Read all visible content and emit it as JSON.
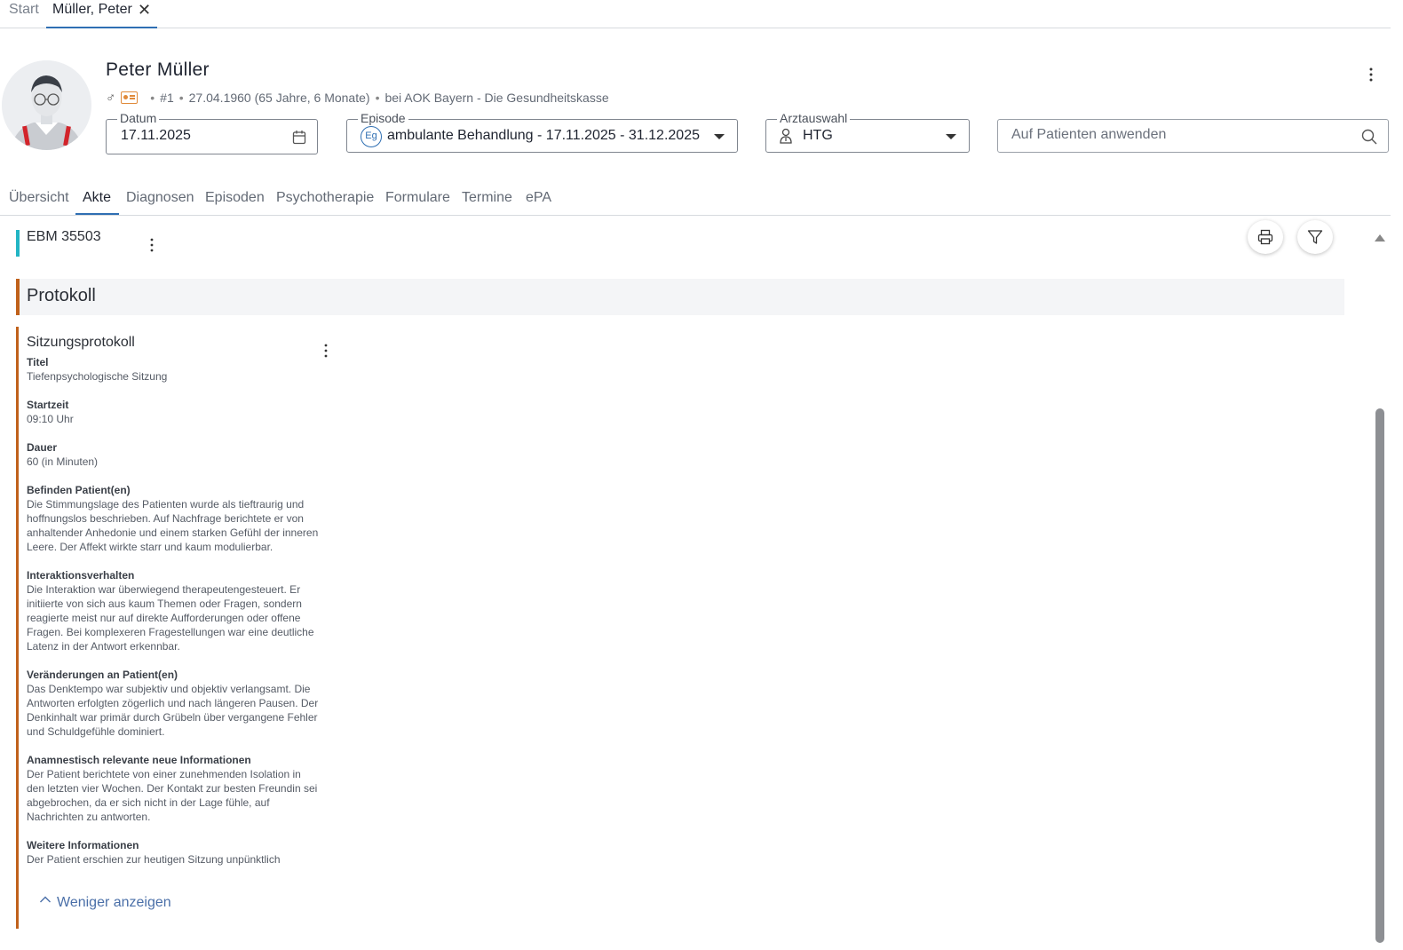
{
  "top_tabs": {
    "start": "Start",
    "patient_tab": "Müller, Peter",
    "close_symbol": "✕"
  },
  "patient": {
    "name": "Peter Müller",
    "gender_symbol": "♂",
    "number": "#1",
    "birth": "27.04.1960 (65 Jahre, 6 Monate)",
    "insurance": "bei AOK Bayern - Die Gesundheitskasse",
    "separator": "•"
  },
  "fields": {
    "datum": {
      "label": "Datum",
      "value": "17.11.2025"
    },
    "episode": {
      "label": "Episode",
      "badge": "Eg",
      "value": "ambulante Behandlung - 17.11.2025 - 31.12.2025"
    },
    "arzt": {
      "label": "Arztauswahl",
      "value": "HTG"
    },
    "search": {
      "placeholder": "Auf Patienten anwenden"
    }
  },
  "section_tabs": [
    "Übersicht",
    "Akte",
    "Diagnosen",
    "Episoden",
    "Psychotherapie",
    "Formulare",
    "Termine",
    "ePA"
  ],
  "ebm": {
    "title": "EBM 35503"
  },
  "protocol": {
    "header": "Protokoll",
    "session_title": "Sitzungsprotokoll",
    "fields": [
      {
        "k": "Titel",
        "v": "Tiefenpsychologische Sitzung"
      },
      {
        "k": "Startzeit",
        "v": "09:10 Uhr"
      },
      {
        "k": "Dauer",
        "v": "60 (in Minuten)"
      },
      {
        "k": "Befinden Patient(en)",
        "v": "Die Stimmungslage des Patienten wurde als tieftraurig und hoffnungslos beschrieben. Auf Nachfrage berichtete er von anhaltender Anhedonie und einem starken Gefühl der inneren Leere. Der Affekt wirkte starr und kaum modulierbar."
      },
      {
        "k": "Interaktionsverhalten",
        "v": "Die Interaktion war überwiegend therapeutengesteuert. Er initiierte von sich aus kaum Themen oder Fragen, sondern reagierte meist nur auf direkte Aufforderungen oder offene Fragen. Bei komplexeren Fragestellungen war eine deutliche Latenz in der Antwort erkennbar."
      },
      {
        "k": "Veränderungen an Patient(en)",
        "v": "Das Denktempo war subjektiv und objektiv verlangsamt. Die Antworten erfolgten zögerlich und nach längeren Pausen. Der Denkinhalt war primär durch Grübeln über vergangene Fehler und Schuldgefühle dominiert."
      },
      {
        "k": "Anamnestisch relevante neue Informationen",
        "v": "Der Patient berichtete von einer zunehmenden Isolation in den letzten vier Wochen. Der Kontakt zur besten Freundin sei abgebrochen, da er sich nicht in der Lage fühle, auf Nachrichten zu antworten."
      },
      {
        "k": "Weitere Informationen",
        "v": "Der Patient erschien zur heutigen Sitzung unpünktlich"
      }
    ],
    "show_less": "Weniger anzeigen"
  },
  "colors": {
    "accent": "#2f6fb3",
    "ebm_marker": "#22b5c4",
    "protocol_marker": "#c0611b",
    "link": "#4a6fa8"
  }
}
